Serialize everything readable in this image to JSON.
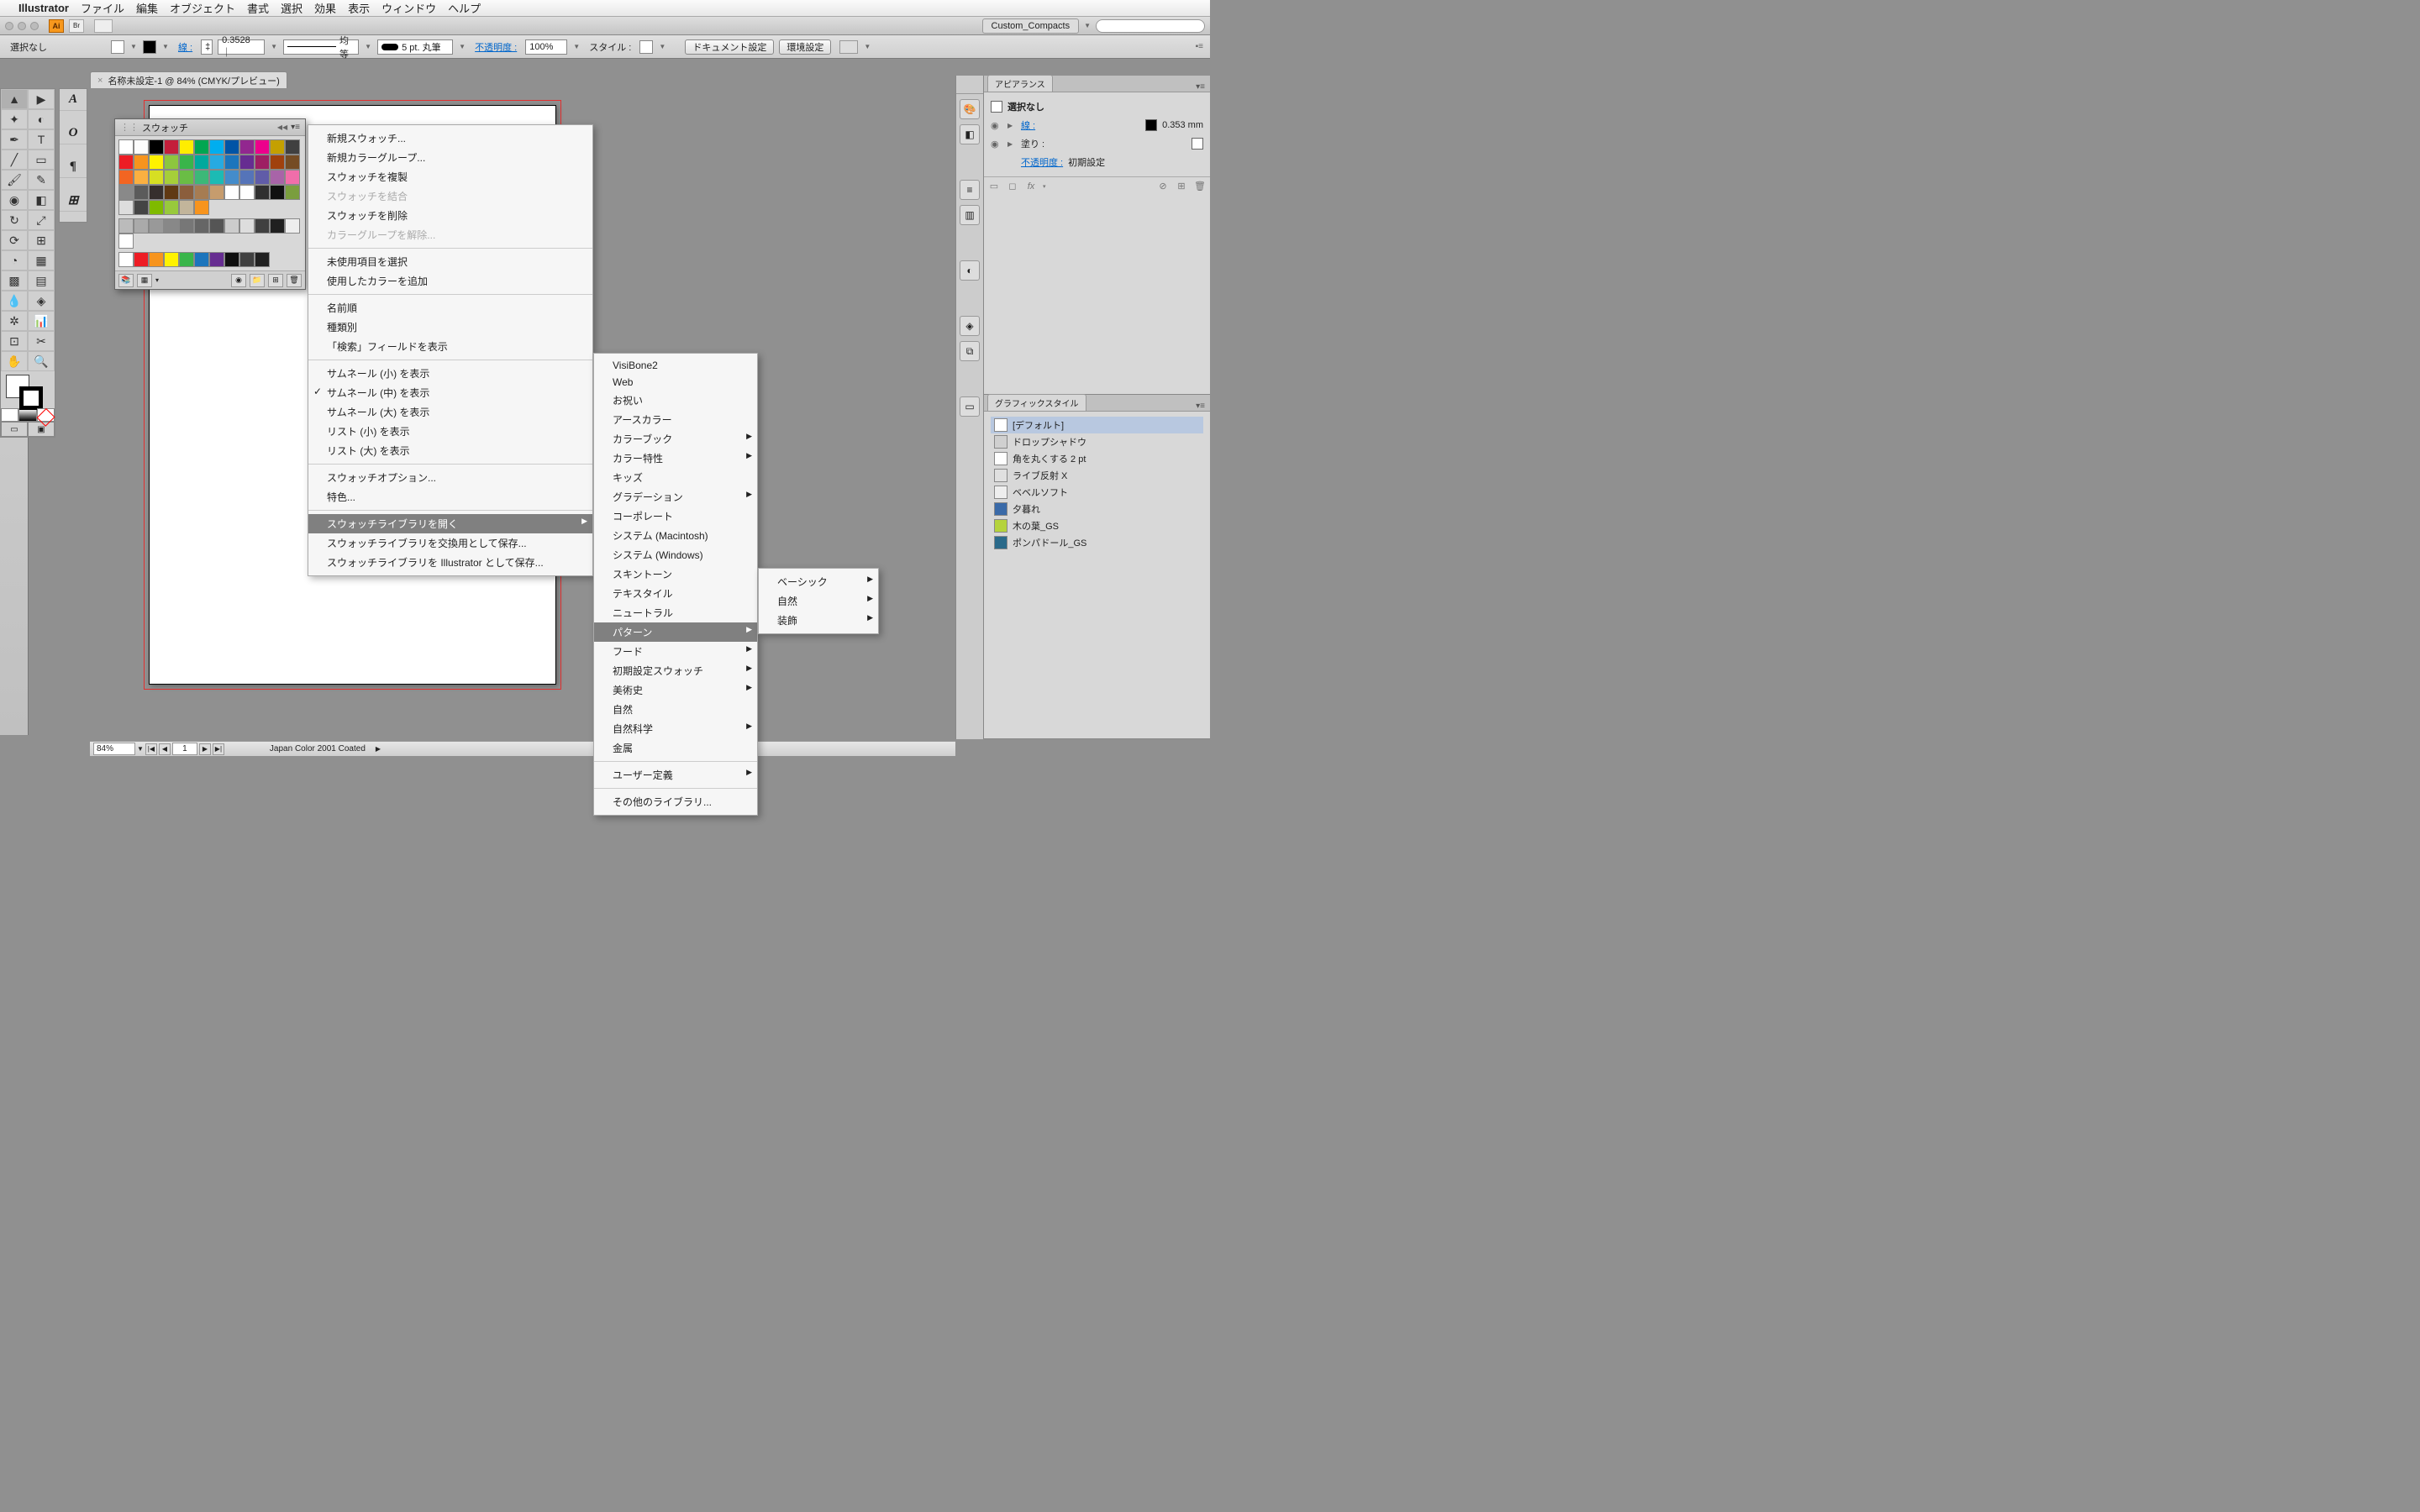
{
  "menubar": {
    "app": "Illustrator",
    "items": [
      "ファイル",
      "編集",
      "オブジェクト",
      "書式",
      "選択",
      "効果",
      "表示",
      "ウィンドウ",
      "ヘルプ"
    ]
  },
  "appbar": {
    "workspace": "Custom_Compacts"
  },
  "controlbar": {
    "selection": "選択なし",
    "stroke_label": "線 :",
    "stroke_weight": "0.3528 ｜",
    "stroke_uniform": "均等",
    "brush": "5 pt. 丸筆",
    "opacity_label": "不透明度 :",
    "opacity_value": "100%",
    "style_label": "スタイル :",
    "btn_doc_setup": "ドキュメント設定",
    "btn_prefs": "環境設定"
  },
  "doc_tab": {
    "title": "名称未設定-1 @ 84% (CMYK/プレビュー)"
  },
  "statusbar": {
    "zoom": "84%",
    "page": "1",
    "profile": "Japan Color 2001 Coated"
  },
  "swatch_panel": {
    "title": "スウォッチ"
  },
  "swatch_colors_row1": [
    "#ffffff",
    "#fcfcfc",
    "#000000",
    "#c41e3a",
    "#ffed00",
    "#00a651",
    "#00aeef",
    "#0054a6",
    "#92278f",
    "#ec008c",
    "#c4a000",
    "#404040"
  ],
  "swatch_colors_row2": [
    "#ed1c24",
    "#f7941d",
    "#fff200",
    "#8dc63e",
    "#39b54a",
    "#00a99d",
    "#27aae1",
    "#1c75bc",
    "#662d91",
    "#9e1f63",
    "#a0410d",
    "#754c24"
  ],
  "swatch_colors_row3": [
    "#f26522",
    "#fbb040",
    "#d7df23",
    "#a6ce39",
    "#6abd45",
    "#3cb878",
    "#1cbbb4",
    "#448ccb",
    "#5574b9",
    "#605ca8",
    "#a864a8",
    "#f06eaa"
  ],
  "swatch_colors_row4": [
    "#898989",
    "#5b5b5b",
    "#362f2d",
    "#603913",
    "#8b5e3c",
    "#a67c52",
    "#c69c6d",
    "#ffffff",
    "#ffffff",
    "#303030",
    "#101010",
    "#7a9e3e"
  ],
  "swatch_colors_row5": [
    "#dddddd",
    "#444444",
    "#7fba00",
    "#98c93c",
    "#c2b59b",
    "#f7941d"
  ],
  "swatch_colors_row6": [
    "#bbbbbb",
    "#aaaaaa",
    "#999999",
    "#888888",
    "#777777",
    "#666666",
    "#555555",
    "#cccccc",
    "#dddddd",
    "#404040",
    "#202020",
    "#eeeeee"
  ],
  "swatch_colors_row7": [
    "#ffffff"
  ],
  "swatch_colors_row8": [
    "#ffffff",
    "#ed1c24",
    "#f7941d",
    "#fff200",
    "#39b54a",
    "#1c75bc",
    "#662d91",
    "#101010",
    "#404040",
    "#202020"
  ],
  "flyout_main": {
    "items": [
      {
        "label": "新規スウォッチ...",
        "enabled": true
      },
      {
        "label": "新規カラーグループ...",
        "enabled": true
      },
      {
        "label": "スウォッチを複製",
        "enabled": true
      },
      {
        "label": "スウォッチを結合",
        "enabled": false
      },
      {
        "label": "スウォッチを削除",
        "enabled": true
      },
      {
        "label": "カラーグループを解除...",
        "enabled": false
      }
    ],
    "items2": [
      {
        "label": "未使用項目を選択"
      },
      {
        "label": "使用したカラーを追加"
      }
    ],
    "items3": [
      {
        "label": "名前順"
      },
      {
        "label": "種類別"
      },
      {
        "label": "「検索」フィールドを表示"
      }
    ],
    "items4": [
      {
        "label": "サムネール (小) を表示",
        "checked": false
      },
      {
        "label": "サムネール (中) を表示",
        "checked": true
      },
      {
        "label": "サムネール (大) を表示",
        "checked": false
      },
      {
        "label": "リスト (小) を表示",
        "checked": false
      },
      {
        "label": "リスト (大) を表示",
        "checked": false
      }
    ],
    "items5": [
      {
        "label": "スウォッチオプション..."
      },
      {
        "label": "特色..."
      }
    ],
    "items6": [
      {
        "label": "スウォッチライブラリを開く",
        "highlight": true,
        "submenu": true
      },
      {
        "label": "スウォッチライブラリを交換用として保存..."
      },
      {
        "label": "スウォッチライブラリを Illustrator として保存..."
      }
    ]
  },
  "flyout_lib": {
    "items": [
      {
        "label": "VisiBone2"
      },
      {
        "label": "Web"
      },
      {
        "label": "お祝い"
      },
      {
        "label": "アースカラー"
      },
      {
        "label": "カラーブック",
        "submenu": true
      },
      {
        "label": "カラー特性",
        "submenu": true
      },
      {
        "label": "キッズ"
      },
      {
        "label": "グラデーション",
        "submenu": true
      },
      {
        "label": "コーポレート"
      },
      {
        "label": "システム (Macintosh)"
      },
      {
        "label": "システム (Windows)"
      },
      {
        "label": "スキントーン"
      },
      {
        "label": "テキスタイル"
      },
      {
        "label": "ニュートラル"
      },
      {
        "label": "パターン",
        "highlight": true,
        "submenu": true
      },
      {
        "label": "フード",
        "submenu": true
      },
      {
        "label": "初期設定スウォッチ",
        "submenu": true
      },
      {
        "label": "美術史",
        "submenu": true
      },
      {
        "label": "自然"
      },
      {
        "label": "自然科学",
        "submenu": true
      },
      {
        "label": "金属"
      }
    ],
    "user_defined": "ユーザー定義",
    "other": "その他のライブラリ..."
  },
  "flyout_pattern": {
    "items": [
      {
        "label": "ベーシック",
        "submenu": true
      },
      {
        "label": "自然",
        "submenu": true
      },
      {
        "label": "装飾",
        "submenu": true
      }
    ]
  },
  "appearance": {
    "title": "アピアランス",
    "selection": "選択なし",
    "stroke_label": "線 :",
    "stroke_value": "0.353 mm",
    "fill_label": "塗り :",
    "opacity_label": "不透明度 :",
    "opacity_value": "初期設定"
  },
  "graphic_styles": {
    "title": "グラフィックスタイル",
    "items": [
      {
        "label": "[デフォルト]",
        "color": "#ffffff"
      },
      {
        "label": "ドロップシャドウ",
        "color": "#d0d0d0"
      },
      {
        "label": "角を丸くする 2 pt",
        "color": "#ffffff"
      },
      {
        "label": "ライブ反射 X",
        "color": "#e0e0e0"
      },
      {
        "label": "ベベルソフト",
        "color": "#eeeeee"
      },
      {
        "label": "夕暮れ",
        "color": "#3a6aa8"
      },
      {
        "label": "木の葉_GS",
        "color": "#b5d33c"
      },
      {
        "label": "ポンパドール_GS",
        "color": "#2a6a8a"
      }
    ]
  }
}
